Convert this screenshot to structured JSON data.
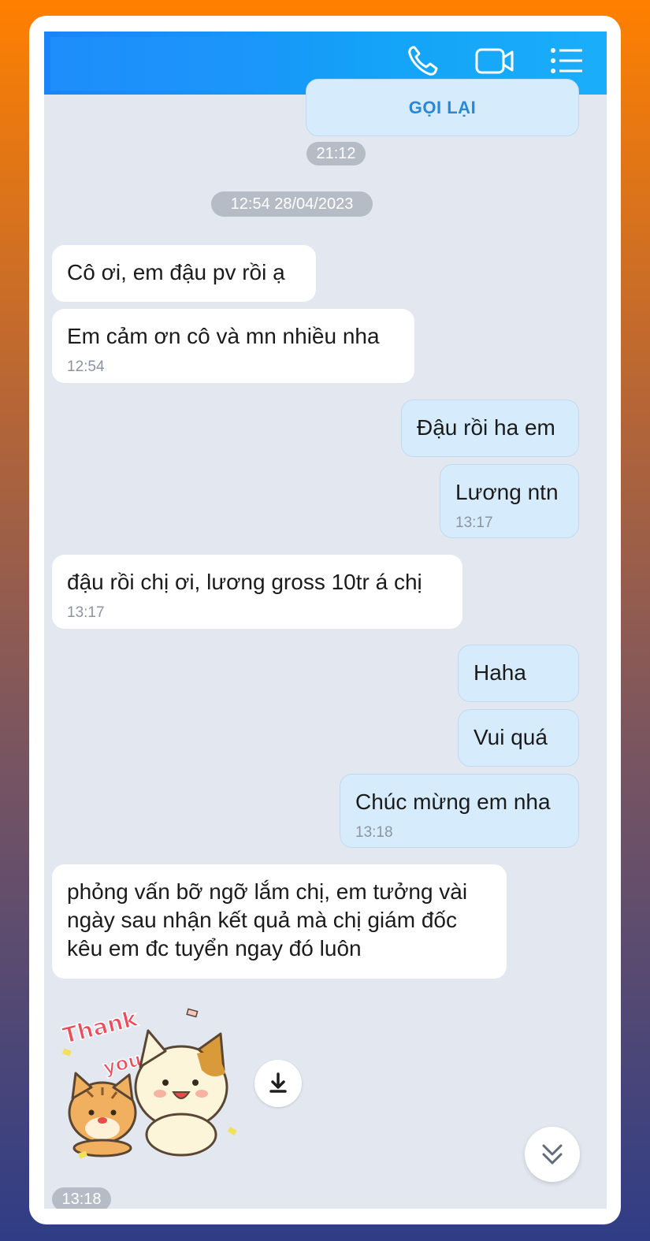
{
  "header": {
    "icons": [
      "phone-icon",
      "video-call-icon",
      "menu-list-icon"
    ],
    "colors": {
      "start": "#1a84f8",
      "end": "#1aaefa"
    }
  },
  "call_card": {
    "button_label": "GỌI LẠI",
    "time": "21:12"
  },
  "date_divider": "12:54 28/04/2023",
  "messages": [
    {
      "dir": "in",
      "text": "Cô ơi, em đậu pv rồi ạ",
      "time": ""
    },
    {
      "dir": "in",
      "text": "Em cảm ơn cô và mn nhiều nha",
      "time": "12:54"
    },
    {
      "dir": "out",
      "text": "Đậu rồi ha em",
      "time": ""
    },
    {
      "dir": "out",
      "text": "Lương ntn",
      "time": "13:17"
    },
    {
      "dir": "in",
      "text": "đậu rồi chị ơi, lương gross 10tr á chị",
      "time": "13:17"
    },
    {
      "dir": "out",
      "text": "Haha",
      "time": ""
    },
    {
      "dir": "out",
      "text": "Vui quá",
      "time": ""
    },
    {
      "dir": "out",
      "text": "Chúc mừng em nha",
      "time": "13:18"
    },
    {
      "dir": "in",
      "lines": [
        "phỏng vấn bỡ ngỡ lắm chị, em tưởng vài",
        "ngày sau nhận kết quả mà chị giám đốc",
        "kêu em đc tuyển ngay đó luôn"
      ],
      "time": ""
    }
  ],
  "sticker": {
    "text_line1": "Thank",
    "text_line2": "you!!",
    "time": "13:18"
  },
  "controls": {
    "download_icon": "download-icon",
    "scroll_icon": "chevron-double-down-icon"
  },
  "colors": {
    "incoming_bg": "#ffffff",
    "outgoing_bg": "#d6ecfd",
    "chat_bg": "#e3e8f0"
  }
}
